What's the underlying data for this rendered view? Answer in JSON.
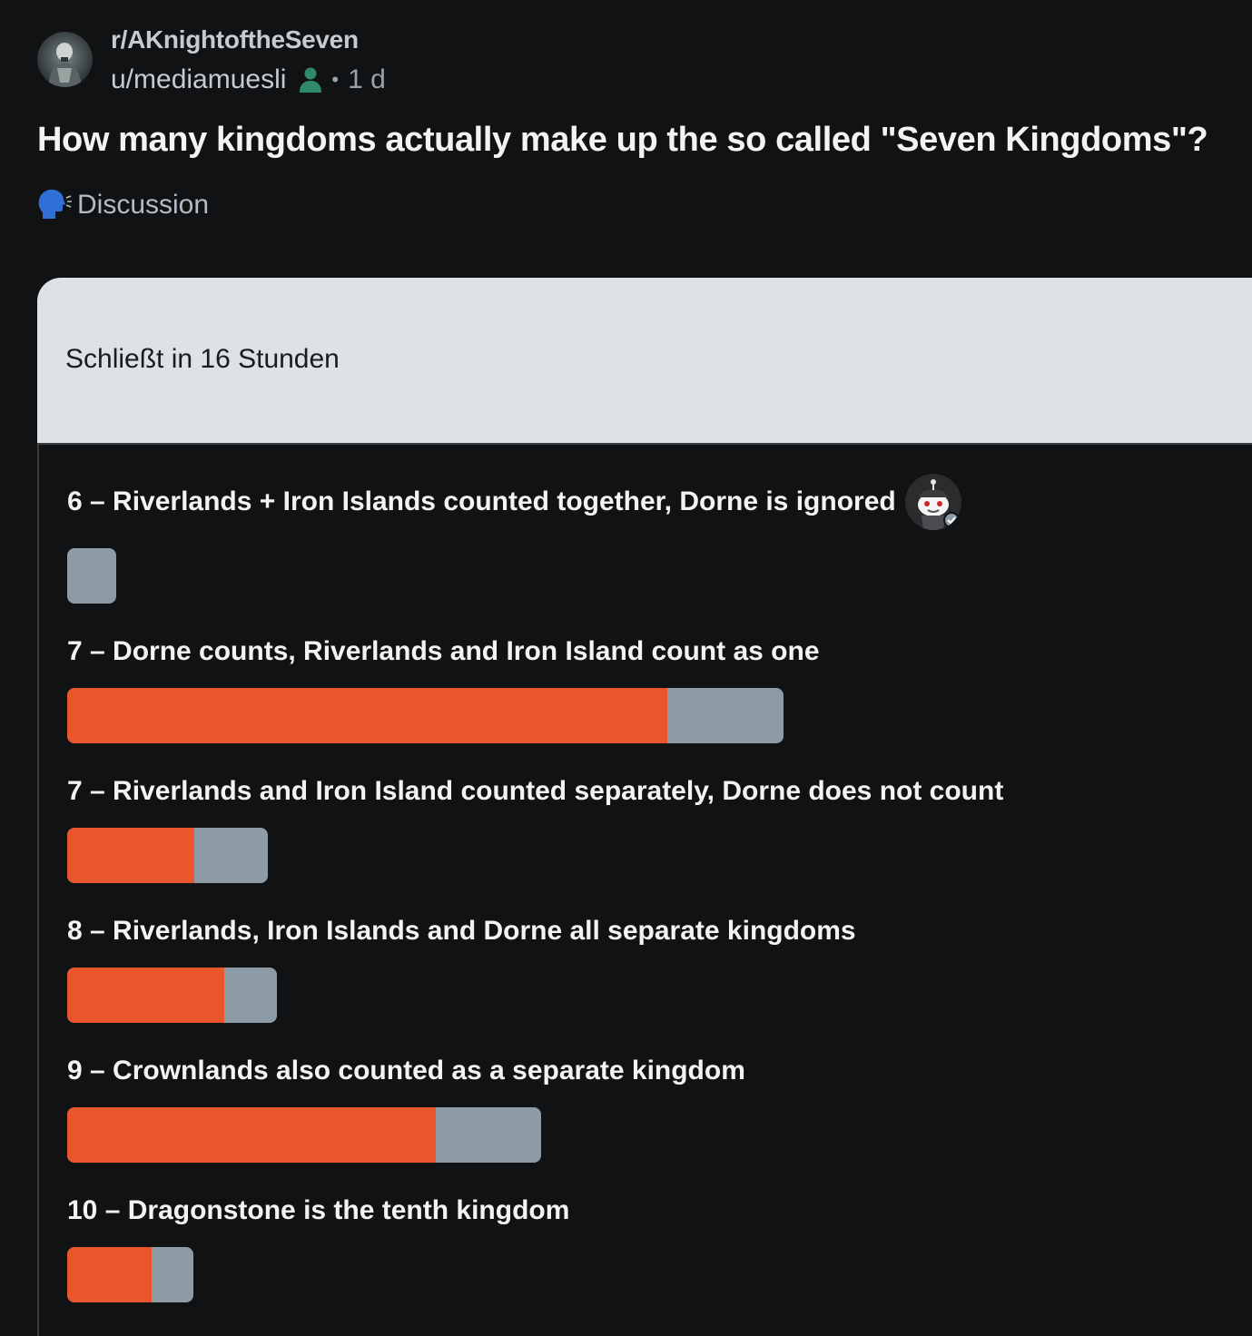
{
  "post": {
    "subreddit": "r/AKnightoftheSeven",
    "author": "u/mediamuesli",
    "separator": "•",
    "age": "1 d",
    "title": "How many kingdoms actually make up the so called \"Seven Kingdoms\"?",
    "flair": "Discussion",
    "icons": {
      "subreddit_avatar": "subreddit-avatar",
      "user": "person-icon",
      "flair": "speaking-head-icon"
    }
  },
  "poll": {
    "status": "Schließt in 16 Stunden",
    "colors": {
      "fill": "#ea562b",
      "track": "#8d9ba7",
      "header_bg": "#dce2e6"
    },
    "options": [
      {
        "label": "6 – Riverlands + Iron Islands counted together, Dorne is ignored",
        "bar_fraction": 0.04,
        "fill_fraction": 0.0,
        "badge": "snoo-avatar-icon"
      },
      {
        "label": "7 – Dorne counts, Riverlands and Iron Island count as one",
        "bar_fraction": 0.59,
        "fill_fraction": 0.838
      },
      {
        "label": "7 – Riverlands and Iron Island counted separately, Dorne does not count",
        "bar_fraction": 0.165,
        "fill_fraction": 0.633
      },
      {
        "label": "8 – Riverlands, Iron Islands and Dorne all separate kingdoms",
        "bar_fraction": 0.173,
        "fill_fraction": 0.75
      },
      {
        "label": "9 – Crownlands also counted as a separate kingdom",
        "bar_fraction": 0.39,
        "fill_fraction": 0.777
      },
      {
        "label": "10 – Dragonstone is the tenth kingdom",
        "bar_fraction": 0.104,
        "fill_fraction": 0.667
      }
    ]
  }
}
